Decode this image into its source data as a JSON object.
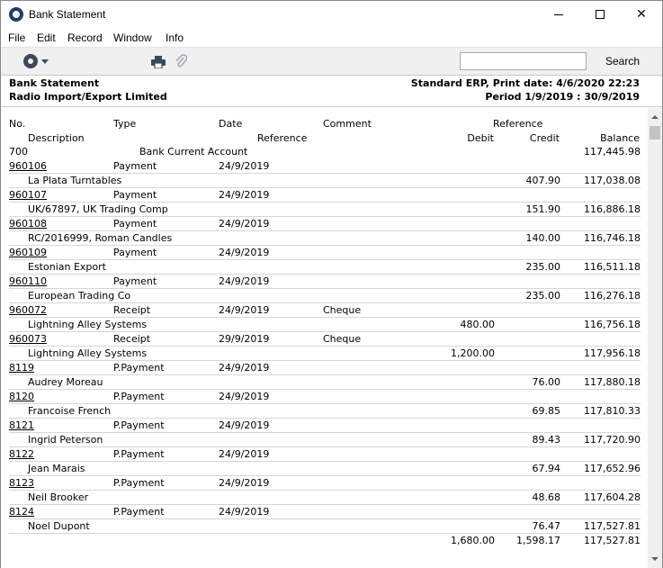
{
  "window": {
    "title": "Bank Statement"
  },
  "menu": [
    "File",
    "Edit",
    "Record",
    "Window",
    "Info"
  ],
  "toolbar": {
    "search_label": "Search",
    "search_value": ""
  },
  "header": {
    "doc_title": "Bank Statement",
    "company": "Radio Import/Export Limited",
    "print_info": "Standard ERP, Print date: 4/6/2020 22:23",
    "period": "Period  1/9/2019 : 30/9/2019"
  },
  "columns": {
    "no": "No.",
    "type": "Type",
    "date": "Date",
    "comment": "Comment",
    "reference": "Reference",
    "description": "Description",
    "reference2": "Reference",
    "debit": "Debit",
    "credit": "Credit",
    "balance": "Balance"
  },
  "account": {
    "number": "700",
    "name": "Bank Current Account",
    "balance": "117,445.98"
  },
  "transactions": [
    {
      "no": "960106",
      "type": "Payment",
      "date": "24/9/2019",
      "comment": "",
      "description": "La Plata Turntables",
      "debit": "",
      "credit": "407.90",
      "balance": "117,038.08"
    },
    {
      "no": "960107",
      "type": "Payment",
      "date": "24/9/2019",
      "comment": "",
      "description": "UK/67897, UK Trading Comp",
      "debit": "",
      "credit": "151.90",
      "balance": "116,886.18"
    },
    {
      "no": "960108",
      "type": "Payment",
      "date": "24/9/2019",
      "comment": "",
      "description": "RC/2016999, Roman Candles",
      "debit": "",
      "credit": "140.00",
      "balance": "116,746.18"
    },
    {
      "no": "960109",
      "type": "Payment",
      "date": "24/9/2019",
      "comment": "",
      "description": "Estonian Export",
      "debit": "",
      "credit": "235.00",
      "balance": "116,511.18"
    },
    {
      "no": "960110",
      "type": "Payment",
      "date": "24/9/2019",
      "comment": "",
      "description": "European Trading Co",
      "debit": "",
      "credit": "235.00",
      "balance": "116,276.18"
    },
    {
      "no": "960072",
      "type": "Receipt",
      "date": "24/9/2019",
      "comment": "Cheque",
      "description": "Lightning Alley Systems",
      "debit": "480.00",
      "credit": "",
      "balance": "116,756.18"
    },
    {
      "no": "960073",
      "type": "Receipt",
      "date": "29/9/2019",
      "comment": "Cheque",
      "description": "Lightning Alley Systems",
      "debit": "1,200.00",
      "credit": "",
      "balance": "117,956.18"
    },
    {
      "no": "8119",
      "type": "P.Payment",
      "date": "24/9/2019",
      "comment": "",
      "description": "Audrey Moreau",
      "debit": "",
      "credit": "76.00",
      "balance": "117,880.18"
    },
    {
      "no": "8120",
      "type": "P.Payment",
      "date": "24/9/2019",
      "comment": "",
      "description": "Francoise French",
      "debit": "",
      "credit": "69.85",
      "balance": "117,810.33"
    },
    {
      "no": "8121",
      "type": "P.Payment",
      "date": "24/9/2019",
      "comment": "",
      "description": "Ingrid Peterson",
      "debit": "",
      "credit": "89.43",
      "balance": "117,720.90"
    },
    {
      "no": "8122",
      "type": "P.Payment",
      "date": "24/9/2019",
      "comment": "",
      "description": "Jean Marais",
      "debit": "",
      "credit": "67.94",
      "balance": "117,652.96"
    },
    {
      "no": "8123",
      "type": "P.Payment",
      "date": "24/9/2019",
      "comment": "",
      "description": "Neil Brooker",
      "debit": "",
      "credit": "48.68",
      "balance": "117,604.28"
    },
    {
      "no": "8124",
      "type": "P.Payment",
      "date": "24/9/2019",
      "comment": "",
      "description": "Noel Dupont",
      "debit": "",
      "credit": "76.47",
      "balance": "117,527.81"
    }
  ],
  "totals": {
    "debit": "1,680.00",
    "credit": "1,598.17",
    "balance": "117,527.81"
  }
}
